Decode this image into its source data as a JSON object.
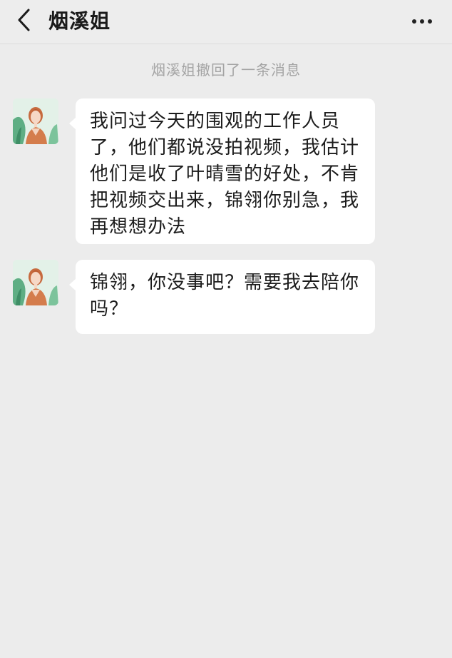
{
  "header": {
    "back_icon": "chevron-left-icon",
    "title": "烟溪姐",
    "more_icon": "more-dots-icon"
  },
  "chat": {
    "recall_notice": "烟溪姐撤回了一条消息",
    "messages": [
      {
        "sender": "烟溪姐",
        "text": "我问过今天的围观的工作人员了，他们都说没拍视频，我估计他们是收了叶晴雪的好处，不肯把视频交出来，锦翎你别急，我再想想办法"
      },
      {
        "sender": "烟溪姐",
        "text": "锦翎，你没事吧？需要我去陪你吗？"
      }
    ]
  },
  "colors": {
    "background": "#ececec",
    "bubble": "#ffffff",
    "notice_text": "#a4a4a4"
  }
}
